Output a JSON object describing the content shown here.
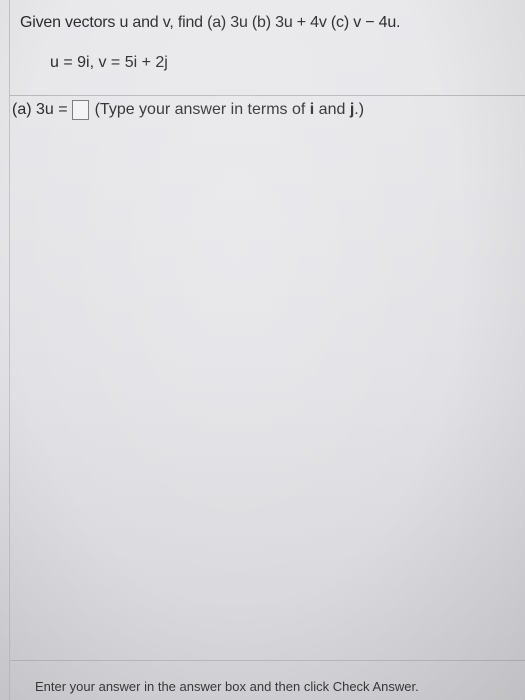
{
  "question": {
    "prompt": "Given vectors u and v, find (a) 3u  (b) 3u + 4v  (c) v − 4u.",
    "vectors": "u = 9i, v = 5i + 2j"
  },
  "answer": {
    "label": "(a) 3u =",
    "value": "",
    "hint_prefix": "(Type your answer in terms of ",
    "hint_i": "i",
    "hint_and": " and ",
    "hint_j": "j",
    "hint_suffix": ".)"
  },
  "footer": {
    "instruction": "Enter your answer in the answer box and then click Check Answer."
  },
  "colors": {
    "background": "#e4e4e8",
    "text": "#2a2a2a"
  }
}
